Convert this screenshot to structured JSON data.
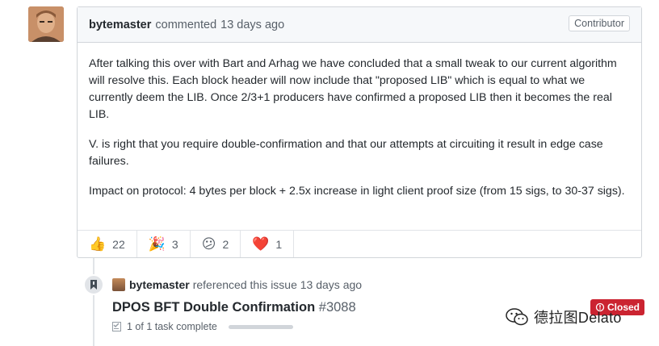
{
  "comment": {
    "author": "bytemaster",
    "action": "commented",
    "time": "13 days ago",
    "badge": "Contributor",
    "paragraphs": [
      "After talking this over with Bart and Arhag we have concluded that a small tweak to our current algorithm will resolve this. Each block header will now include that \"proposed LIB\" which is equal to what we currently deem the LIB. Once 2/3+1 producers have confirmed a proposed LIB then it becomes the real LIB.",
      "V. is right that you require double-confirmation and that our attempts at circuiting it result in edge case failures.",
      "Impact on protocol: 4 bytes per block + 2.5x increase in light client proof size (from 15 sigs, to 30-37 sigs)."
    ],
    "reactions": [
      {
        "icon": "thumbs-up-icon",
        "emoji": "👍",
        "count": "22"
      },
      {
        "icon": "party-popper-icon",
        "emoji": "🎉",
        "count": "3"
      },
      {
        "icon": "confused-face-icon",
        "emoji": "😕",
        "count": "2"
      },
      {
        "icon": "heart-icon",
        "emoji": "❤️",
        "count": "1"
      }
    ]
  },
  "event": {
    "author": "bytemaster",
    "text": "referenced this issue 13 days ago",
    "issue_title": "DPOS BFT Double Confirmation",
    "issue_number": "#3088",
    "tasks": "1 of 1 task complete",
    "task_progress": 1.0,
    "status": "Closed"
  },
  "watermark": "德拉图Delato",
  "colors": {
    "closed": "#cb2431",
    "border": "#d1d5da",
    "header_bg": "#f6f8fa"
  }
}
